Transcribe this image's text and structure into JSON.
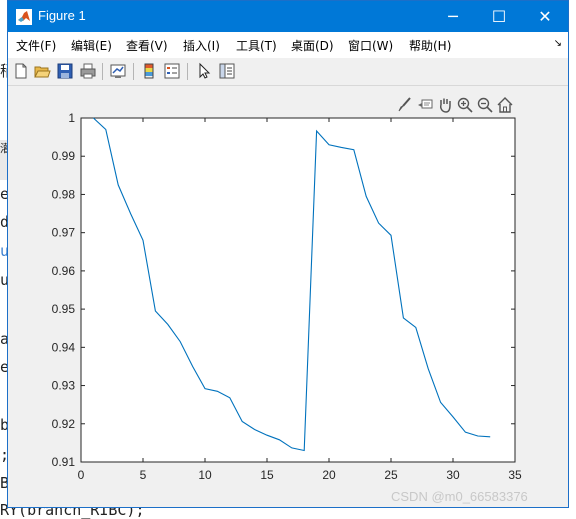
{
  "window": {
    "title": "Figure 1",
    "minimize_glyph": "─",
    "maximize_glyph": "☐",
    "close_glyph": "✕"
  },
  "menu": {
    "items": [
      "文件(F)",
      "编辑(E)",
      "查看(V)",
      "插入(I)",
      "工具(T)",
      "桌面(D)",
      "窗口(W)",
      "帮助(H)"
    ],
    "overflow_glyph": "↘"
  },
  "toolbar": {
    "icons": [
      "new-figure-icon",
      "open-file-icon",
      "save-icon",
      "print-icon",
      "link-plot-icon",
      "colorbar-icon",
      "legend-icon",
      "pointer-icon",
      "property-editor-icon"
    ]
  },
  "axes_toolbar": {
    "icons": [
      "brush-icon",
      "datatip-icon",
      "pan-icon",
      "zoom-in-icon",
      "zoom-out-icon",
      "home-icon"
    ]
  },
  "background": {
    "lines": [
      "稍",
      "灌",
      "e",
      "d",
      "u",
      "u",
      "a",
      "e",
      " (",
      "b",
      ";",
      "B",
      "RY(branch_RIBC);"
    ]
  },
  "watermark": "CSDN @m0_66583376",
  "chart_data": {
    "type": "line",
    "title": "",
    "xlabel": "",
    "ylabel": "",
    "xlim": [
      0,
      35
    ],
    "ylim": [
      0.91,
      1
    ],
    "xticks": [
      0,
      5,
      10,
      15,
      20,
      25,
      30,
      35
    ],
    "yticks": [
      0.91,
      0.92,
      0.93,
      0.94,
      0.95,
      0.96,
      0.97,
      0.98,
      0.99,
      1
    ],
    "ytick_labels": [
      "0.91",
      "0.92",
      "0.93",
      "0.94",
      "0.95",
      "0.96",
      "0.97",
      "0.98",
      "0.99",
      "1"
    ],
    "grid": false,
    "color": "#0072bd",
    "series": [
      {
        "x": [
          1,
          2,
          3,
          4,
          5,
          6,
          7,
          8,
          9,
          10,
          11,
          12,
          13,
          14,
          15,
          16,
          17,
          18,
          19,
          20,
          21,
          22,
          23,
          24,
          25,
          26,
          27,
          28,
          29,
          30,
          31,
          32,
          33
        ],
        "values": [
          1.0,
          0.997,
          0.9825,
          0.975,
          0.968,
          0.9495,
          0.946,
          0.9415,
          0.935,
          0.9292,
          0.9285,
          0.9268,
          0.9206,
          0.9185,
          0.917,
          0.9158,
          0.9137,
          0.913,
          0.9966,
          0.993,
          0.9923,
          0.9917,
          0.9795,
          0.9725,
          0.9693,
          0.9477,
          0.9452,
          0.9344,
          0.9256,
          0.9218,
          0.9178,
          0.9168,
          0.9166
        ]
      }
    ]
  }
}
